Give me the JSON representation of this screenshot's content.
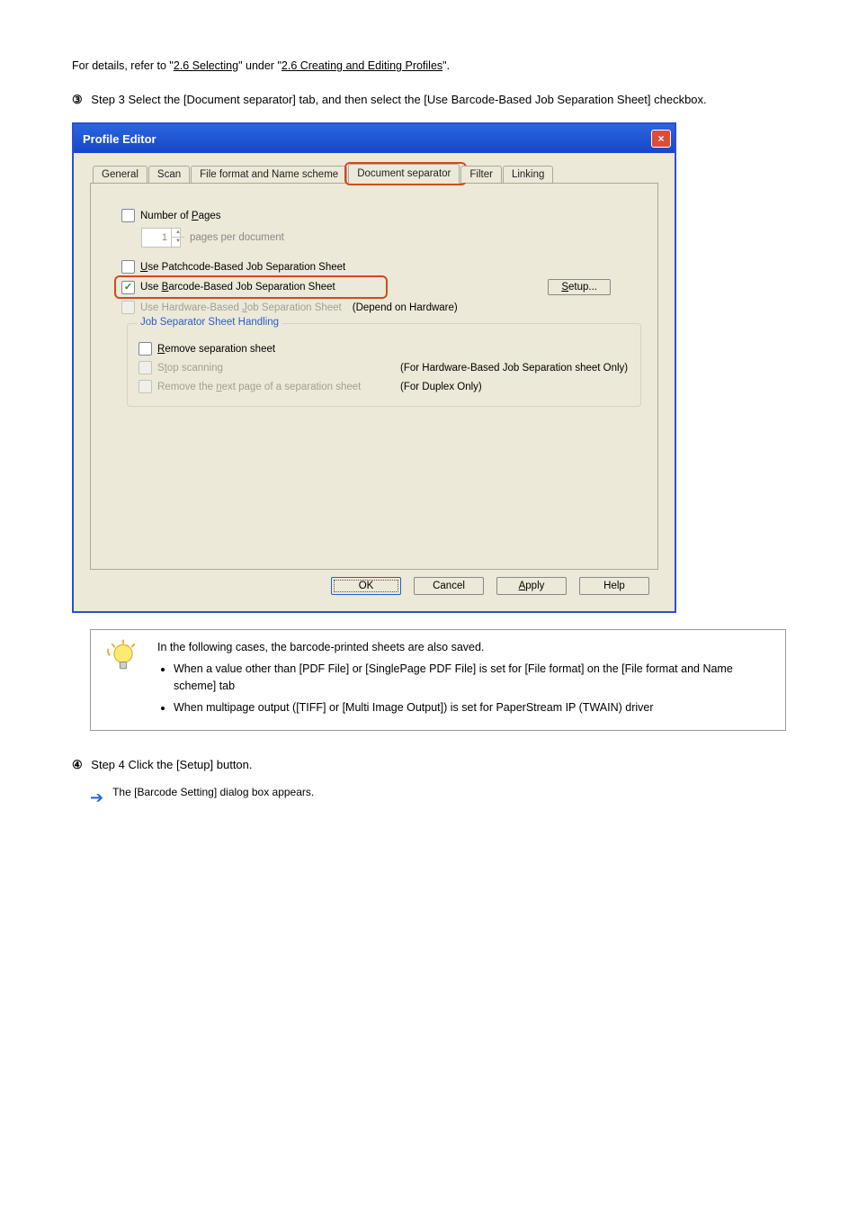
{
  "intro": {
    "line1a": "For details, refer to \"",
    "line1link": "2.6 Selecting",
    "line1b": "\" under \"",
    "line1link2": "2.6 Creating and Editing Profiles",
    "line1c": "\".",
    "line2": "Step 3 Select the [Document separator] tab, and then select the [Use Barcode-Based Job Separation Sheet] checkbox.",
    "step3_num": "③"
  },
  "dialog": {
    "title": "Profile Editor",
    "tabs": [
      "General",
      "Scan",
      "File format and Name scheme",
      "Document separator",
      "Filter",
      "Linking"
    ],
    "activeTab": 3,
    "numPages": {
      "label_pre": "Number of ",
      "mn": "P",
      "label_post": "ages",
      "value": "1",
      "per": "pages per document"
    },
    "patch": {
      "mn": "U",
      "pre": "",
      "post": "se Patchcode-Based Job Separation Sheet"
    },
    "barcode": {
      "pre": "Use ",
      "mn": "B",
      "post": "arcode-Based Job Separation Sheet"
    },
    "setup": {
      "mn": "S",
      "post": "etup..."
    },
    "hardware": {
      "pre": "Use Hardware-Based ",
      "mn": "J",
      "post": "ob Separation Sheet",
      "hint": "(Depend on Hardware)"
    },
    "legend": "Job Separator Sheet Handling",
    "remove": {
      "mn": "R",
      "post": "emove separation sheet"
    },
    "stop": {
      "pre": "S",
      "mn": "t",
      "post": "op scanning",
      "hint": "(For Hardware-Based Job Separation sheet Only)"
    },
    "removenext": {
      "pre": "Remove the ",
      "mn": "n",
      "post": "ext page of a separation sheet",
      "hint": "(For Duplex Only)"
    },
    "buttons": {
      "ok": "OK",
      "cancel": "Cancel",
      "apply_mn": "A",
      "apply": "pply",
      "help": "Help"
    }
  },
  "hint": {
    "line1": "In the following cases, the barcode-printed sheets are also saved.",
    "li1a": "When a value other than [PDF File] or [SinglePage PDF File] is set for [File format] on the [File format and Name scheme] tab",
    "li2": "When multipage output ([TIFF] or [Multi Image Output]) is set for PaperStream IP (TWAIN) driver"
  },
  "step4": {
    "num": "④",
    "text": "Step 4 Click the [Setup] button.",
    "result": "The [Barcode Setting] dialog box appears."
  }
}
